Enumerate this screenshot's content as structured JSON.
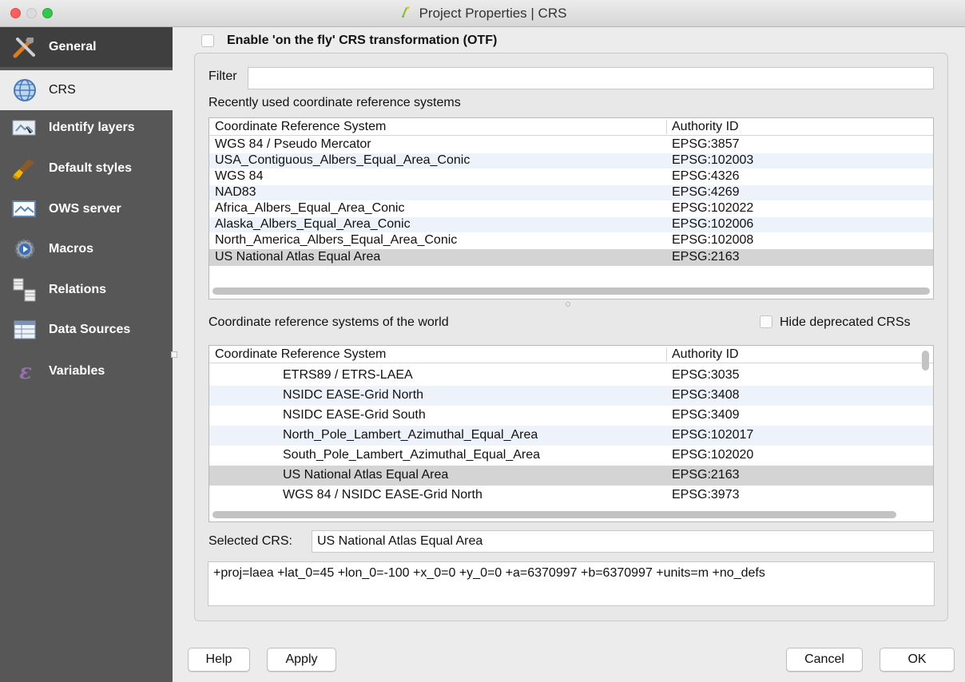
{
  "window": {
    "title": "Project Properties | CRS"
  },
  "sidebar": {
    "items": [
      {
        "label": "General",
        "icon": "general-tools-icon"
      },
      {
        "label": "CRS",
        "icon": "globe-icon"
      },
      {
        "label": "Identify layers",
        "icon": "identify-layers-icon"
      },
      {
        "label": "Default styles",
        "icon": "brush-icon"
      },
      {
        "label": "OWS server",
        "icon": "ows-server-icon"
      },
      {
        "label": "Macros",
        "icon": "macros-icon"
      },
      {
        "label": "Relations",
        "icon": "relations-icon"
      },
      {
        "label": "Data Sources",
        "icon": "data-sources-icon"
      },
      {
        "label": "Variables",
        "icon": "variables-icon"
      }
    ],
    "active_index": 1
  },
  "otf": {
    "label": "Enable 'on the fly' CRS transformation (OTF)",
    "checked": false
  },
  "filter": {
    "label": "Filter",
    "value": ""
  },
  "recent": {
    "heading": "Recently used coordinate reference systems",
    "columns": [
      "Coordinate Reference System",
      "Authority ID"
    ],
    "rows": [
      {
        "crs": "WGS 84 / Pseudo Mercator",
        "auth": "EPSG:3857"
      },
      {
        "crs": "USA_Contiguous_Albers_Equal_Area_Conic",
        "auth": "EPSG:102003"
      },
      {
        "crs": "WGS 84",
        "auth": "EPSG:4326"
      },
      {
        "crs": "NAD83",
        "auth": "EPSG:4269"
      },
      {
        "crs": "Africa_Albers_Equal_Area_Conic",
        "auth": "EPSG:102022"
      },
      {
        "crs": "Alaska_Albers_Equal_Area_Conic",
        "auth": "EPSG:102006"
      },
      {
        "crs": "North_America_Albers_Equal_Area_Conic",
        "auth": "EPSG:102008"
      },
      {
        "crs": "US National Atlas Equal Area",
        "auth": "EPSG:2163"
      }
    ],
    "selected_index": 7
  },
  "world": {
    "heading": "Coordinate reference systems of the world",
    "hide_deprecated_label": "Hide deprecated CRSs",
    "hide_deprecated_checked": false,
    "columns": [
      "Coordinate Reference System",
      "Authority ID"
    ],
    "rows": [
      {
        "crs": "ETRS89 / ETRS-LAEA",
        "auth": "EPSG:3035"
      },
      {
        "crs": "NSIDC EASE-Grid North",
        "auth": "EPSG:3408"
      },
      {
        "crs": "NSIDC EASE-Grid South",
        "auth": "EPSG:3409"
      },
      {
        "crs": "North_Pole_Lambert_Azimuthal_Equal_Area",
        "auth": "EPSG:102017"
      },
      {
        "crs": "South_Pole_Lambert_Azimuthal_Equal_Area",
        "auth": "EPSG:102020"
      },
      {
        "crs": "US National Atlas Equal Area",
        "auth": "EPSG:2163"
      },
      {
        "crs": "WGS 84 / NSIDC EASE-Grid North",
        "auth": "EPSG:3973"
      }
    ],
    "selected_index": 5
  },
  "selected_crs": {
    "label": "Selected CRS:",
    "value": "US National Atlas Equal Area"
  },
  "proj_string": "+proj=laea +lat_0=45 +lon_0=-100 +x_0=0 +y_0=0 +a=6370997 +b=6370997 +units=m +no_defs",
  "buttons": {
    "help": "Help",
    "apply": "Apply",
    "cancel": "Cancel",
    "ok": "OK"
  }
}
